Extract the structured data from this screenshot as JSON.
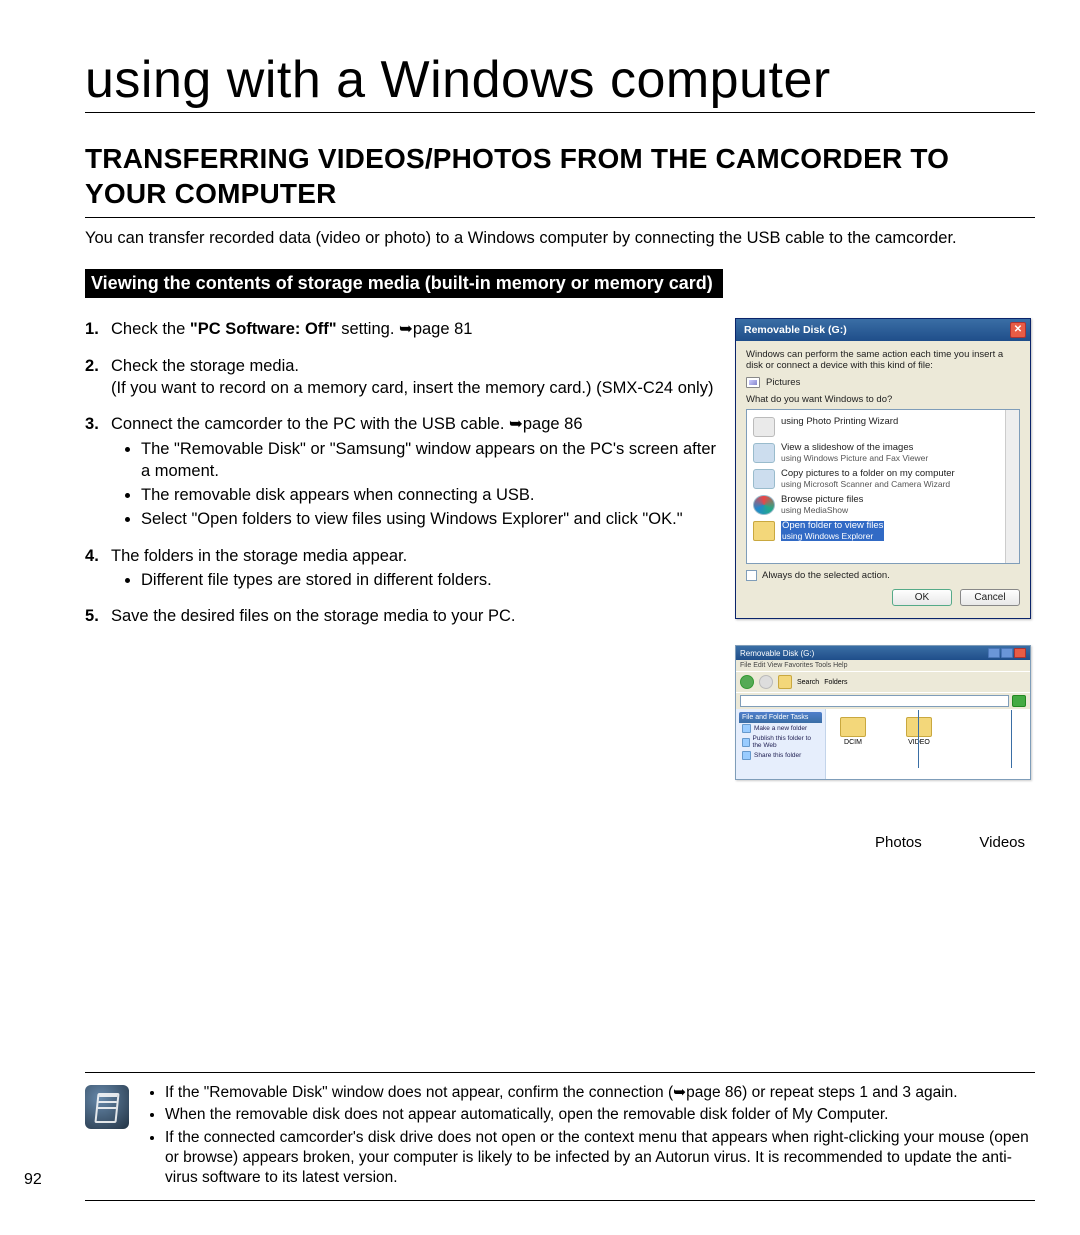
{
  "page_title": "using with a Windows computer",
  "section_heading": "TRANSFERRING VIDEOS/PHOTOS FROM THE CAMCORDER TO YOUR COMPUTER",
  "intro": "You can transfer recorded data (video or photo) to a Windows computer by connecting the USB cable to the camcorder.",
  "black_bar": "Viewing the contents of storage media (built-in memory or memory card)",
  "steps": {
    "s1_pre": "Check the ",
    "s1_bold": "\"PC Software: Off\"",
    "s1_post": " setting. ➥page 81",
    "s2_line1": "Check the storage media.",
    "s2_line2": "(If you want to record on a memory card, insert the memory card.) (SMX-C24 only)",
    "s3_line": "Connect the camcorder to the PC with the USB cable. ➥page 86",
    "s3_b1": "The \"Removable Disk\" or \"Samsung\" window appears on the PC's screen after a moment.",
    "s3_b2": "The removable disk appears when connecting a USB.",
    "s3_b3": "Select \"Open folders to view files using Windows Explorer\" and click \"OK.\"",
    "s4_line": "The folders in the storage media appear.",
    "s4_b1": "Different file types are stored in different folders.",
    "s5_line": "Save the desired files on the storage media to your PC."
  },
  "dialog": {
    "title": "Removable Disk (G:)",
    "desc": "Windows can perform the same action each time you insert a disk or connect a device with this kind of file:",
    "pictures": "Pictures",
    "prompt": "What do you want Windows to do?",
    "opt1_t": "using Photo Printing Wizard",
    "opt2_t": "View a slideshow of the images",
    "opt2_s": "using Windows Picture and Fax Viewer",
    "opt3_t": "Copy pictures to a folder on my computer",
    "opt3_s": "using Microsoft Scanner and Camera Wizard",
    "opt4_t": "Browse picture files",
    "opt4_s": "using MediaShow",
    "opt5_t": "Open folder to view files",
    "opt5_s": "using Windows Explorer",
    "check": "Always do the selected action.",
    "ok": "OK",
    "cancel": "Cancel"
  },
  "explorer": {
    "title": "Removable Disk (G:)",
    "menu": "File   Edit   View   Favorites   Tools   Help",
    "search": "Search",
    "folders": "Folders",
    "side_hdr": "File and Folder Tasks",
    "side_l1": "Make a new folder",
    "side_l2": "Publish this folder to the Web",
    "side_l3": "Share this folder",
    "f1": "DCIM",
    "f2": "VIDEO"
  },
  "callouts": {
    "photos": "Photos",
    "videos": "Videos"
  },
  "notes": {
    "n1": "If the \"Removable Disk\" window does not appear, confirm the connection (➥page 86) or repeat steps 1 and 3 again.",
    "n2": "When the removable disk does not appear automatically, open the removable disk folder of My Computer.",
    "n3": "If the connected camcorder's disk drive does not open or the context menu that appears when right-clicking your mouse (open or browse) appears broken, your computer is likely to be infected by an Autorun virus. It is recommended to update the anti-virus software to its latest version."
  },
  "page_number": "92"
}
